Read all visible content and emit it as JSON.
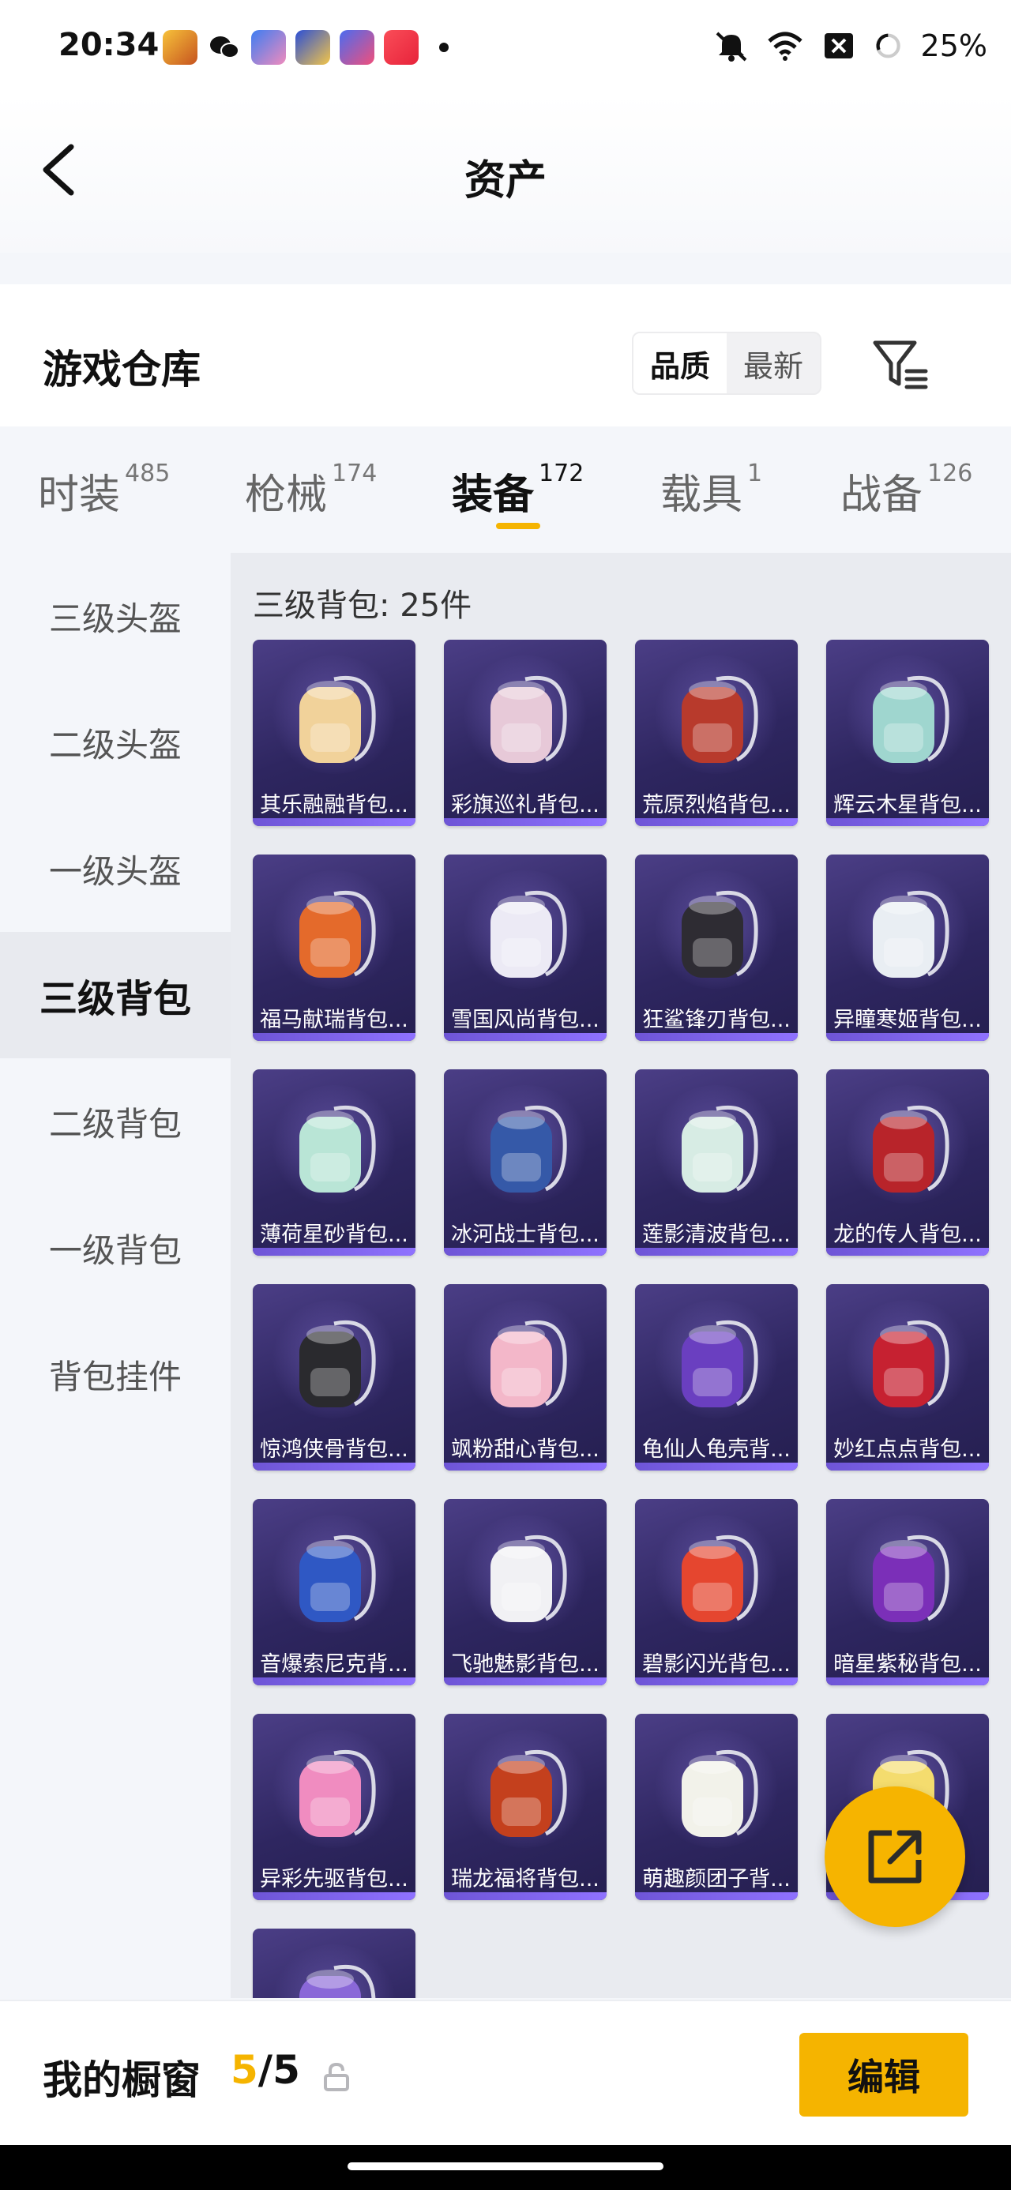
{
  "status_bar": {
    "time": "20:34",
    "battery": "25%",
    "app_icons": [
      "game-app-icon",
      "wechat-icon",
      "game-app-icon-2",
      "game-app-icon-3",
      "star-app-icon",
      "music-app-icon"
    ],
    "icons": [
      "mute-icon",
      "wifi-icon",
      "close-box-icon",
      "battery-ring-icon"
    ]
  },
  "header": {
    "title": "资产",
    "back_icon": "chevron-left-icon"
  },
  "section": {
    "title": "游戏仓库",
    "sort_options": [
      "品质",
      "最新"
    ],
    "active_sort": "品质",
    "filter_icon": "filter-icon"
  },
  "tabs": [
    {
      "label": "时装",
      "count": "485"
    },
    {
      "label": "枪械",
      "count": "174"
    },
    {
      "label": "装备",
      "count": "172"
    },
    {
      "label": "载具",
      "count": "1"
    },
    {
      "label": "战备",
      "count": "126"
    }
  ],
  "active_tab": "装备",
  "sidebar": {
    "items": [
      "三级头盔",
      "二级头盔",
      "一级头盔",
      "三级背包",
      "二级背包",
      "一级背包",
      "背包挂件"
    ],
    "active": "三级背包"
  },
  "content": {
    "heading": "三级背包: 25件",
    "items": [
      {
        "name": "其乐融融背包...",
        "color": "#f1d29a"
      },
      {
        "name": "彩旗巡礼背包...",
        "color": "#e7c9d8"
      },
      {
        "name": "荒原烈焰背包...",
        "color": "#b83a2c"
      },
      {
        "name": "辉云木星背包...",
        "color": "#9fd6cf"
      },
      {
        "name": "福马献瑞背包...",
        "color": "#e46a2b"
      },
      {
        "name": "雪国风尚背包...",
        "color": "#eceaf5"
      },
      {
        "name": "狂鲨锋刃背包...",
        "color": "#2e2c33"
      },
      {
        "name": "异瞳寒姬背包...",
        "color": "#e9eef3"
      },
      {
        "name": "薄荷星砂背包...",
        "color": "#b9e5d6"
      },
      {
        "name": "冰河战士背包...",
        "color": "#3559a8"
      },
      {
        "name": "莲影清波背包...",
        "color": "#d7ece4"
      },
      {
        "name": "龙的传人背包...",
        "color": "#b8242a"
      },
      {
        "name": "惊鸿侠骨背包...",
        "color": "#2a2a2e"
      },
      {
        "name": "飒粉甜心背包...",
        "color": "#f3b7c9"
      },
      {
        "name": "龟仙人龟壳背...",
        "color": "#6a3fc0"
      },
      {
        "name": "妙红点点背包...",
        "color": "#c62131"
      },
      {
        "name": "音爆索尼克背...",
        "color": "#2f58c4"
      },
      {
        "name": "飞驰魅影背包...",
        "color": "#f1f1f4"
      },
      {
        "name": "碧影闪光背包...",
        "color": "#e5462f"
      },
      {
        "name": "暗星紫秘背包...",
        "color": "#7b2fb8"
      },
      {
        "name": "异彩先驱背包...",
        "color": "#f08cc0"
      },
      {
        "name": "瑞龙福将背包...",
        "color": "#c4401d"
      },
      {
        "name": "萌趣颜团子背...",
        "color": "#f2f2ea"
      },
      {
        "name": "",
        "color": "#f4dc6e"
      },
      {
        "name": "",
        "color": "#8a68d8"
      }
    ]
  },
  "fab": {
    "icon": "share-external-icon"
  },
  "bottom": {
    "label": "我的橱窗",
    "current": "5",
    "total": "5",
    "lock_icon": "lock-icon",
    "edit_label": "编辑"
  }
}
